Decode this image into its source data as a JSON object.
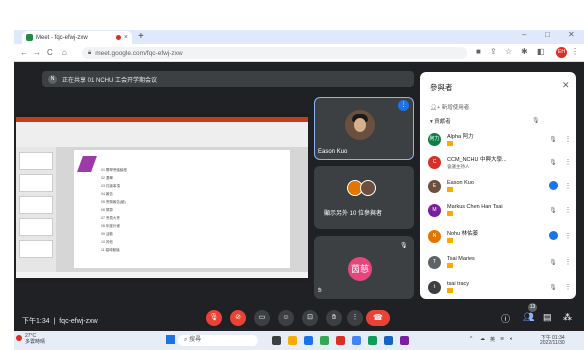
{
  "browser": {
    "tab_title": "Meet - fqc-efwj-zxw",
    "new_tab": "+",
    "url": "meet.google.com/fqc-efwj-zxw",
    "profile_initial": "EH",
    "minimize": "–",
    "maximize": "□",
    "close": "✕"
  },
  "meet": {
    "banner_initial": "N",
    "banner_text": "正在共享 01 NCHU 工会开学期会议",
    "tiles": [
      {
        "name": "Eason Kuo"
      },
      {
        "name": "顯示另外 10 位參與者"
      },
      {
        "name": "茵慈",
        "avatar": "茵慈"
      }
    ],
    "time": "下午1:34",
    "meeting_code": "fqc-efwj-zxw",
    "people_count": "13"
  },
  "panel": {
    "title": "參與者",
    "add_people": "新增使用者",
    "section": "貢獻者",
    "participants": [
      {
        "initials": "阿力",
        "name": "Alpha 阿力",
        "color": "#0b8043"
      },
      {
        "initials": "C",
        "name": "CCM_NCHU 中興大學...",
        "sub": "會議主持人",
        "color": "#d93025"
      },
      {
        "initials": "E",
        "name": "Eason Kuo",
        "color": "#6b4f3f"
      },
      {
        "initials": "M",
        "name": "Markus Chen Han Tsai",
        "color": "#7b1fa2"
      },
      {
        "initials": "N",
        "name": "Nohu 林佑蓁",
        "color": "#e37400"
      },
      {
        "initials": "T",
        "name": "Tsai Maries",
        "color": "#5f6368"
      },
      {
        "initials": "t",
        "name": "tsai tracy",
        "color": "#3c4043"
      }
    ]
  },
  "taskbar": {
    "weather_temp": "27°C",
    "weather_text": "多雲時晴",
    "search": "搜尋",
    "lang": "英",
    "clock_time": "下午 01:34",
    "clock_date": "2022/11/30"
  },
  "slide": {
    "rows": [
      "01 開學會議議程",
      "02 選舉",
      "03 討論事項",
      "04 報告",
      "05 會務報告(續)",
      "06 預算",
      "07 會員大會",
      "08 年度計畫",
      "09 活動",
      "10 其他",
      "11 臨時動議"
    ]
  }
}
